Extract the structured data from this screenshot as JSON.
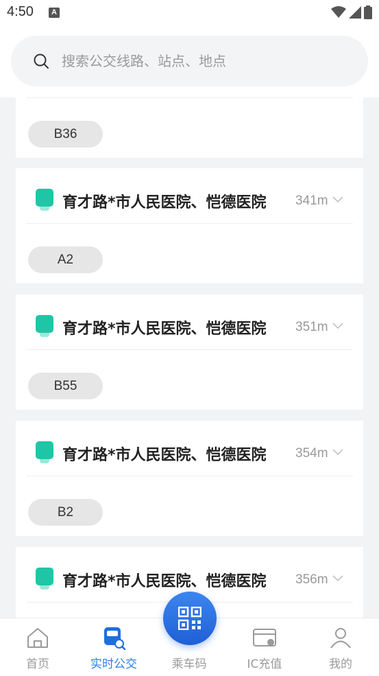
{
  "status_bar": {
    "time": "4:50",
    "notification_icon": "A"
  },
  "search": {
    "placeholder": "搜索公交线路、站点、地点"
  },
  "stops": [
    {
      "name": "",
      "distance": "",
      "routes": [
        "B36"
      ]
    },
    {
      "name": "育才路*市人民医院、恺德医院",
      "distance": "341m",
      "routes": [
        "A2"
      ]
    },
    {
      "name": "育才路*市人民医院、恺德医院",
      "distance": "351m",
      "routes": [
        "B55"
      ]
    },
    {
      "name": "育才路*市人民医院、恺德医院",
      "distance": "354m",
      "routes": [
        "B2"
      ]
    },
    {
      "name": "育才路*市人民医院、恺德医院",
      "distance": "356m",
      "routes": []
    }
  ],
  "nav": {
    "home": "首页",
    "realtime": "实时公交",
    "ride_code": "乘车码",
    "ic_recharge": "IC充值",
    "mine": "我的"
  },
  "colors": {
    "accent": "#2a7fe8",
    "stop_icon": "#1fc6a6",
    "badge_bg": "#e6e6e6"
  }
}
